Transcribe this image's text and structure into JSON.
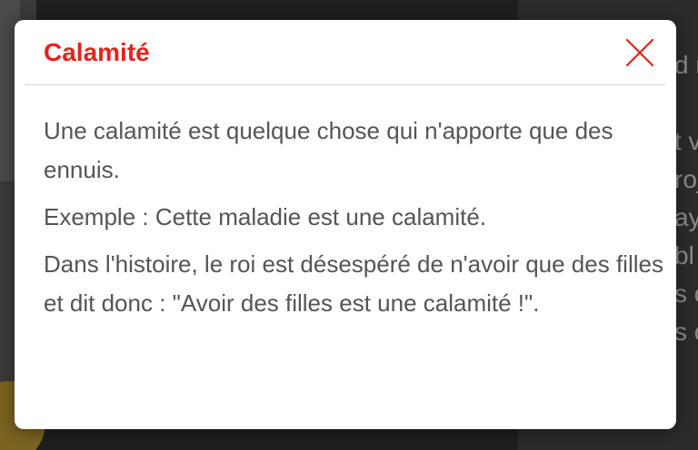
{
  "modal": {
    "title": "Calamité",
    "accent_color": "#e5231b",
    "close_icon": "close-icon",
    "paragraphs": [
      "Une calamité est quelque chose qui n'apporte que des ennuis.",
      "Exemple : Cette maladie est une calamité.",
      "Dans l'histoire, le roi est désespéré de n'avoir que des filles et dit donc : \"Avoir des filles est une calamité !\"."
    ]
  },
  "background": {
    "right_text_fragments": [
      "",
      "d r",
      "",
      "t v",
      "roj",
      "ay",
      "bl",
      "s c",
      "s c"
    ]
  }
}
